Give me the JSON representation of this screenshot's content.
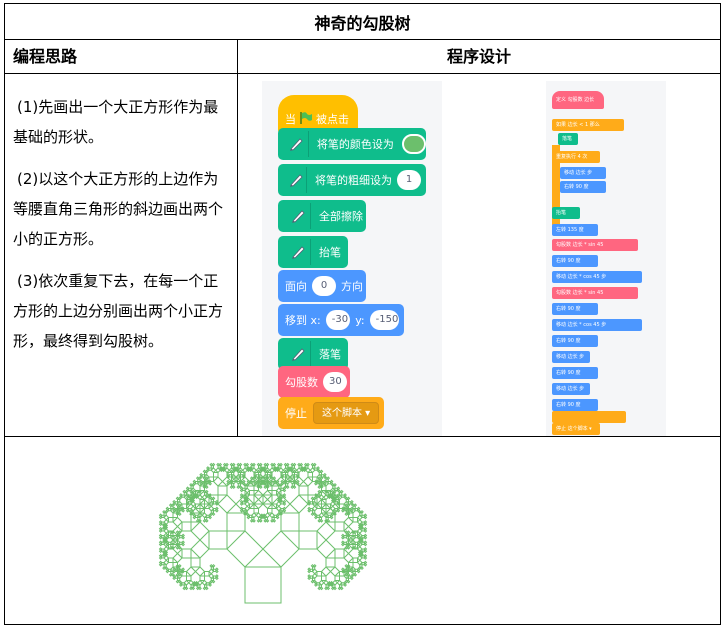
{
  "title": "神奇的勾股树",
  "headers": {
    "left": "编程思路",
    "right": "程序设计"
  },
  "steps": [
    "(1)先画出一个大正方形作为最基础的形状。",
    "(2)以这个大正方形的上边作为等腰直角三角形的斜边画出两个小的正方形。",
    "(3)依次重复下去，在每一个正方形的上边分别画出两个小正方形，最终得到勾股树。"
  ],
  "main_script": {
    "when_flag": "当",
    "when_flag_suffix": "被点击",
    "set_pen_color": "将笔的颜色设为",
    "set_pen_size": "将笔的粗细设为",
    "pen_size_value": "1",
    "erase_all": "全部擦除",
    "pen_up": "抬笔",
    "point_dir": "面向",
    "point_dir_value": "0",
    "point_dir_suffix": "方向",
    "goto": "移到 x:",
    "goto_x": "-30",
    "goto_y_label": "y:",
    "goto_y": "-150",
    "pen_down": "落笔",
    "call": "勾股数",
    "call_value": "30",
    "stop": "停止",
    "stop_option": "这个脚本 ▾",
    "pen_color": "#6cbf6c"
  },
  "define_script": {
    "define": "定义 勾股数 边长",
    "if": "如果 边长 < 1 那么",
    "stop_small": "停止 这个脚本 ▾",
    "pen_down": "落笔",
    "repeat": "重复执行 4 次",
    "move": "移动 边长 步",
    "turn": "右转 90 度",
    "pen_up": "抬笔",
    "turn_left_45": "左转 135 度",
    "recurse": "勾股数 边长 * sin 45",
    "move_neg": "移动 边长 * cos 45 步"
  },
  "colors": {
    "event": "#ffbf00",
    "pen": "#0fbd8c",
    "motion": "#4c97ff",
    "myblocks": "#ff6680",
    "control": "#ffab19",
    "tree": "#6cbf6c"
  }
}
